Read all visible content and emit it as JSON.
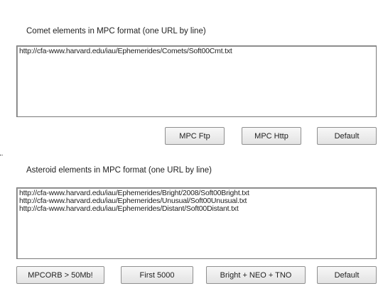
{
  "comets": {
    "label": "Comet elements in MPC format (one URL by line)",
    "urls": [
      "http://cfa-www.harvard.edu/iau/Ephemerides/Comets/Soft00Cmt.txt"
    ],
    "buttons": {
      "mpc_ftp": "MPC Ftp",
      "mpc_http": "MPC Http",
      "default": "Default"
    }
  },
  "asteroids": {
    "label": "Asteroid elements in MPC format (one URL by line)",
    "urls": [
      "http://cfa-www.harvard.edu/iau/Ephemerides/Bright/2008/Soft00Bright.txt",
      "http://cfa-www.harvard.edu/iau/Ephemerides/Unusual/Soft00Unusual.txt",
      "http://cfa-www.harvard.edu/iau/Ephemerides/Distant/Soft00Distant.txt"
    ],
    "buttons": {
      "mpcorb": "MPCORB > 50Mb!",
      "first_5000": "First 5000",
      "bright_neo_tno": "Bright + NEO + TNO",
      "default": "Default"
    }
  }
}
